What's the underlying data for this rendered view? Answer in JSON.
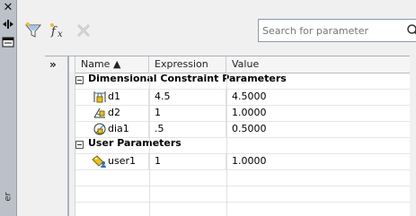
{
  "sidebar": {
    "close_icon": "close-icon",
    "pin_icon": "auto-hide-icon",
    "props_icon": "properties-icon",
    "vertical_label": "er"
  },
  "toolbar": {
    "buttons": [
      {
        "name": "filter-button",
        "icon": "funnel-icon",
        "enabled": true
      },
      {
        "name": "new-user-parameter-button",
        "icon": "fx-icon",
        "enabled": true
      },
      {
        "name": "delete-button",
        "icon": "delete-x-icon",
        "enabled": false
      }
    ],
    "search": {
      "placeholder": "Search for parameter",
      "value": ""
    }
  },
  "gutter": {
    "expand_glyph": "»"
  },
  "grid": {
    "columns": [
      {
        "key": "name",
        "label": "Name ▲"
      },
      {
        "key": "expression",
        "label": "Expression"
      },
      {
        "key": "value",
        "label": "Value"
      }
    ],
    "groups": [
      {
        "title": "Dimensional Constraint Parameters",
        "rows": [
          {
            "name": "d1",
            "expression": "4.5",
            "value": "4.5000",
            "icon": "linear-dimension-lock-icon"
          },
          {
            "name": "d2",
            "expression": "1",
            "value": "1.0000",
            "icon": "angular-dimension-lock-icon"
          },
          {
            "name": "dia1",
            "expression": ".5",
            "value": "0.5000",
            "icon": "diameter-lock-icon"
          }
        ]
      },
      {
        "title": "User Parameters",
        "rows": [
          {
            "name": "user1",
            "expression": "1",
            "value": "1.0000",
            "icon": "user-parameter-icon"
          }
        ]
      }
    ]
  },
  "colors": {
    "accent": "#2f6fb5",
    "dimension_yellow": "#e8c21c",
    "strip": "#bcc1c9"
  }
}
